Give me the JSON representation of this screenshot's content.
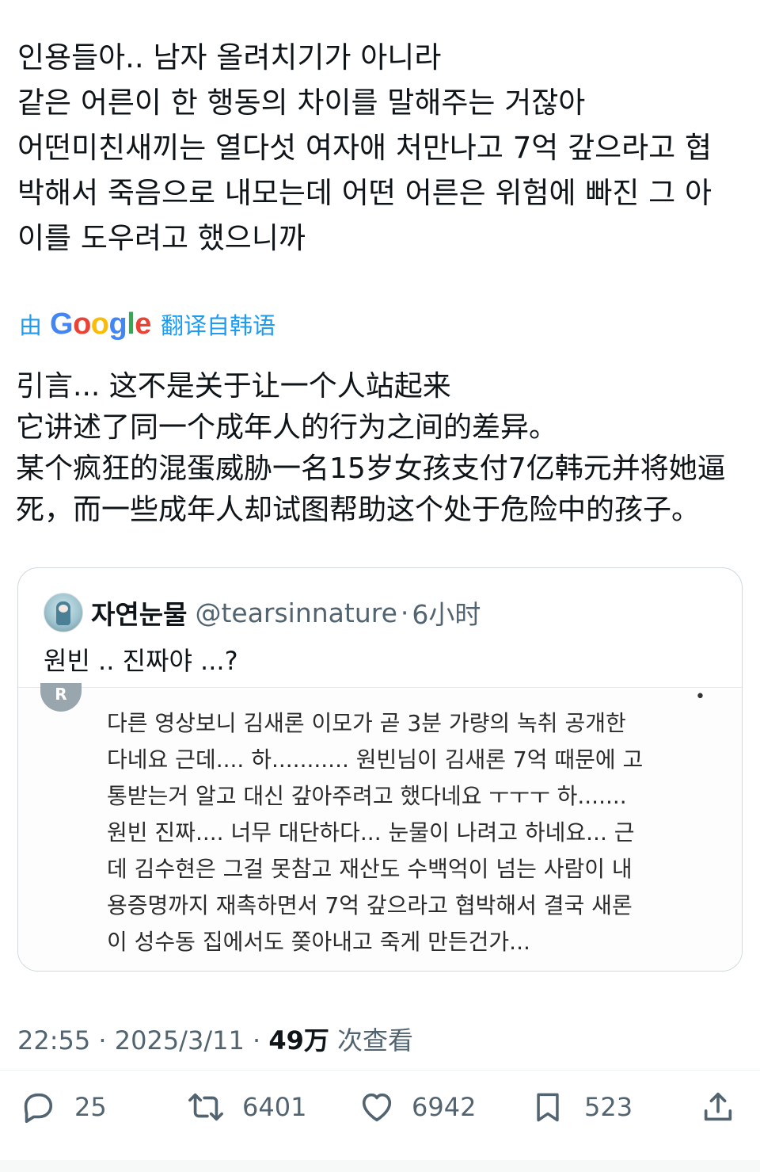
{
  "tweet": {
    "text_lines": [
      "인용들아.. 남자 올려치기가 아니라",
      "같은 어른이 한 행동의 차이를 말해주는 거잖아",
      "어떤미친새끼는 열다섯 여자애 처만나고 7억 갚으라고 협",
      "박해서 죽음으로 내모는데 어떤 어른은 위험에 빠진 그 아",
      "이를 도우려고 했으니까"
    ]
  },
  "translation": {
    "by_label": "由",
    "provider": "Google",
    "suffix_label": "翻译自韩语",
    "text_lines": [
      "引言... 这不是关于让一个人站起来",
      "它讲述了同一个成年人的行为之间的差异。",
      "某个疯狂的混蛋威胁一名15岁女孩支付7亿韩元并将她逼",
      "死，而一些成年人却试图帮助这个处于危险中的孩子。"
    ]
  },
  "quote": {
    "display_name": "자연눈물",
    "handle": "@tearsinnature",
    "separator": "·",
    "time": "6小时",
    "text": "원빈 .. 진짜야 ...?",
    "embedded": {
      "avatar_letter": "R",
      "menu_glyph": "•",
      "text_lines": [
        "다른 영상보니 김새론 이모가 곧 3분 가량의 녹취 공개한",
        "다네요 근데.... 하........... 원빈님이 김새론 7억 때문에 고",
        "통받는거 알고 대신 갚아주려고 했다네요 ㅜㅜㅜ 하.......",
        "원빈 진짜.... 너무 대단하다... 눈물이 나려고 하네요... 근",
        "데 김수현은 그걸 못참고 재산도 수백억이 넘는 사람이 내",
        "용증명까지 재촉하면서 7억 갚으라고 협박해서 결국 새론",
        "이 성수동 집에서도 쫒아내고 죽게 만든건가..."
      ]
    }
  },
  "meta": {
    "time": "22:55",
    "sep1": "·",
    "date": "2025/3/11",
    "sep2": "·",
    "views": "49万",
    "views_label": "次查看"
  },
  "actions": {
    "reply_count": "25",
    "retweet_count": "6401",
    "like_count": "6942",
    "bookmark_count": "523",
    "icons": [
      "reply-icon",
      "retweet-icon",
      "like-icon",
      "bookmark-icon",
      "share-icon"
    ]
  },
  "colors": {
    "link_blue": "#1d9bf0",
    "muted_gray": "#536471",
    "text_black": "#0f1419",
    "border": "#cfd9de"
  }
}
